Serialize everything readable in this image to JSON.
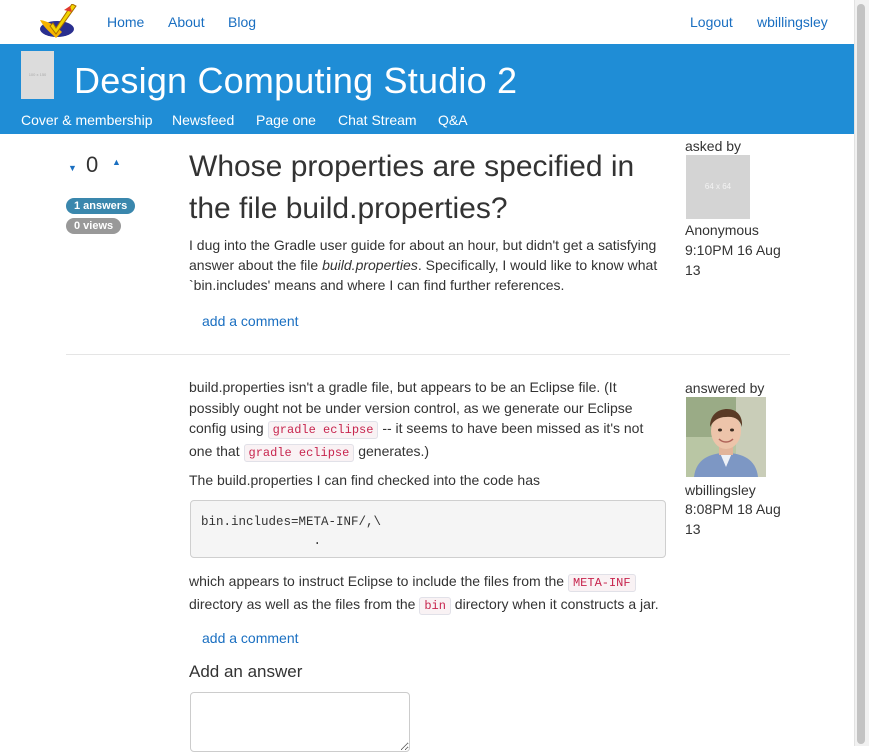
{
  "top_nav": {
    "logo_icon": "checkmark-logo-icon",
    "home": "Home",
    "about": "About",
    "blog": "Blog",
    "logout": "Logout",
    "username": "wbillingsley"
  },
  "banner": {
    "thumb_text": "100 x 150",
    "title": "Design Computing Studio 2",
    "subnav": [
      "Cover & membership",
      "Newsfeed",
      "Page one",
      "Chat Stream",
      "Q&A"
    ]
  },
  "question": {
    "votes": "0",
    "answers_badge": "1 answers",
    "views_badge": "0 views",
    "title": "Whose properties are specified in the file build.properties?",
    "body_pre": "I dug into the Gradle user guide for about an hour, but didn't get a satisfying answer about the file ",
    "body_em": "build.properties",
    "body_post": ". Specifically, I would like to know what `bin.includes' means and where I can find further references.",
    "comment_link": "add a comment",
    "asked_label": "asked by",
    "avatar_text": "64 x 64",
    "author": "Anonymous",
    "date": "9:10PM 16 Aug 13"
  },
  "answer": {
    "p1_a": "build.properties isn't a gradle file, but appears to be an Eclipse file. (It possibly ought not be under version control, as we generate our Eclipse config using ",
    "p1_code1": "gradle eclipse",
    "p1_b": " -- it seems to have been missed as it's not one that ",
    "p1_code2": "gradle eclipse",
    "p1_c": " generates.)",
    "p2": "The build.properties I can find checked into the code has",
    "code_block": "bin.includes=META-INF/,\\\n               .",
    "p3_a": "which appears to instruct Eclipse to include the files from the ",
    "p3_code1": "META-INF",
    "p3_b": " directory as well as the files from the ",
    "p3_code2": "bin",
    "p3_c": " directory when it constructs a jar.",
    "comment_link": "add a comment",
    "answered_label": "answered by",
    "author": "wbillingsley",
    "date": "8:08PM 18 Aug 13"
  },
  "add_answer": {
    "heading": "Add an answer",
    "placeholder": ""
  },
  "colors": {
    "banner": "#1f8dd6",
    "link": "#1a6fc1",
    "badge_answers": "#3a87ad",
    "badge_views": "#999999",
    "code_text": "#c7254e"
  }
}
